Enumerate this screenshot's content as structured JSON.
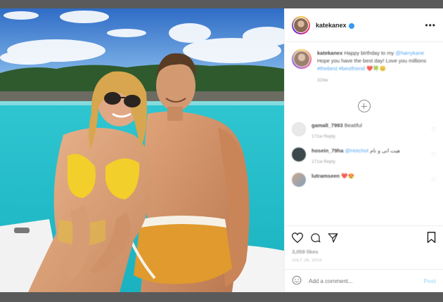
{
  "post": {
    "username": "katekanex",
    "caption_user": "katekanex",
    "caption_text": "Happy birthday to my",
    "caption_mention": "@harrykane",
    "caption_text2": "Hope you have the best day! Love you millions",
    "caption_tags": "#thebest #bestfriend",
    "caption_emoji": "❤️🍀😊",
    "caption_time": "324w",
    "likes": "3,059 likes",
    "date": "JULY 28, 2015",
    "add_comment_placeholder": "Add a comment...",
    "post_label": "Post"
  },
  "comments": [
    {
      "user": "gamalI_7993",
      "text": "Beatiful",
      "meta": "171w   Reply",
      "avatar": "gray"
    },
    {
      "user": "hosein_79ha",
      "mention": "@Hotchot",
      "text": "هیت اتی",
      "text2": "و نام",
      "meta": "171w   Reply",
      "avatar": "dark"
    },
    {
      "user": "lutramseen",
      "text": "❤️😍",
      "meta": "",
      "avatar": "multi"
    }
  ],
  "icons": {
    "more": "more-options-icon",
    "like": "heart-icon",
    "comment": "comment-icon",
    "share": "share-icon",
    "save": "bookmark-icon",
    "emoji": "emoji-icon"
  },
  "colors": {
    "accent": "#3897f0",
    "sea": "#3ccfd6",
    "sky": "#3f7fd0"
  }
}
